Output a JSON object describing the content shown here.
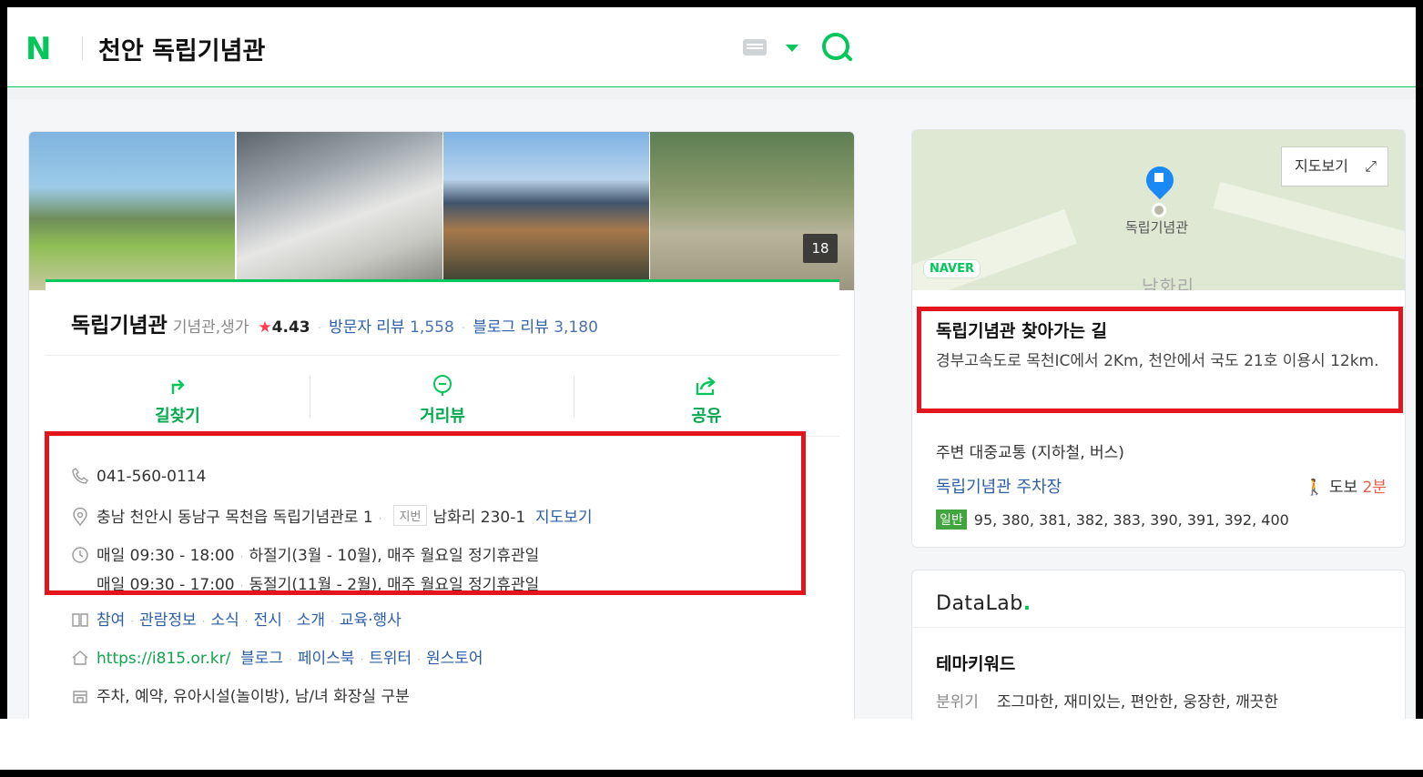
{
  "header": {
    "logo": "N",
    "query": "천안 독립기념관"
  },
  "place": {
    "photo_count": "18",
    "name": "독립기념관",
    "category": "기념관,생가",
    "star": "★",
    "rating": "4.43",
    "visitor_review_label": "방문자 리뷰",
    "visitor_review_count": "1,558",
    "blog_review_label": "블로그 리뷰",
    "blog_review_count": "3,180",
    "actions": [
      {
        "label": "길찾기",
        "icon": "directions-icon"
      },
      {
        "label": "거리뷰",
        "icon": "streetview-icon"
      },
      {
        "label": "공유",
        "icon": "share-icon"
      }
    ],
    "phone": "041-560-0114",
    "address": "충남 천안시 동남구 목천읍 독립기념관로 1",
    "jibun_label": "지번",
    "jibun_address": "남화리 230-1",
    "map_link": "지도보기",
    "hours": [
      {
        "time": "매일 09:30 - 18:00",
        "note": "하절기(3월 - 10월), 매주 월요일 정기휴관일"
      },
      {
        "time": "매일 09:30 - 17:00",
        "note": "동절기(11월 - 2월), 매주 월요일 정기휴관일"
      }
    ],
    "menu_links": [
      "참여",
      "관람정보",
      "소식",
      "전시",
      "소개",
      "교육·행사"
    ],
    "homepage": "https://i815.or.kr/",
    "social_links": [
      "블로그",
      "페이스북",
      "트위터",
      "원스토어"
    ],
    "facilities": "주차, 예약, 유아시설(놀이방), 남/녀 화장실 구분"
  },
  "route": {
    "map_button": "지도보기",
    "map_pin_label": "독립기념관",
    "map_badge": "NAVER",
    "map_area": "남화리",
    "title": "독립기념관 찾아가는 길",
    "description": "경부고속도로 목천IC에서 2Km, 천안에서 국도 21호 이용시 12km.",
    "transit_heading": "주변 대중교통 (지하철, 버스)",
    "stop_name": "독립기념관 주차장",
    "walk_label": "도보",
    "walk_minutes": "2분",
    "bus_type": "일반",
    "bus_numbers": "95,   380,   381,   382,   383,   390,   391,   392,   400"
  },
  "datalab": {
    "logo": "DataLab",
    "logo_dot": ".",
    "heading": "테마키워드",
    "mood_label": "분위기",
    "mood_values": "조그마한, 재미있는, 편안한, 웅장한, 깨끗한"
  },
  "colors": {
    "naver_green": "#03c75a",
    "highlight_red": "#e3141c",
    "link_blue": "#2c5ea8"
  }
}
